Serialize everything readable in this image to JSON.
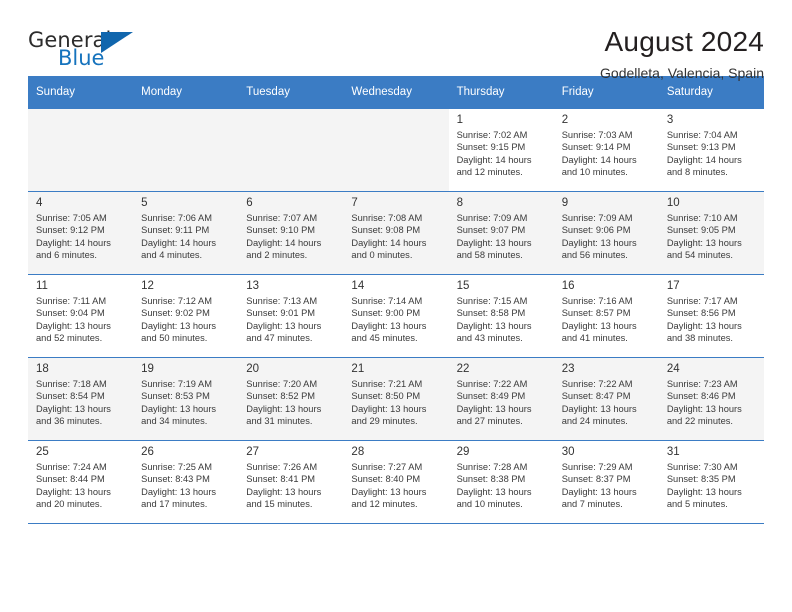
{
  "logo": {
    "word_one": "General",
    "word_two": "Blue",
    "triangle_icon": "blue-triangle-icon",
    "accent_color": "#1673bd"
  },
  "header": {
    "title": "August 2024",
    "subtitle": "Godelleta, Valencia, Spain",
    "header_bg_color": "#3b7cc4",
    "header_text_color": "#ffffff"
  },
  "weekday_headers": [
    "Sunday",
    "Monday",
    "Tuesday",
    "Wednesday",
    "Thursday",
    "Friday",
    "Saturday"
  ],
  "labels": {
    "sunrise_prefix": "Sunrise:",
    "sunset_prefix": "Sunset:",
    "daylight_prefix": "Daylight:"
  },
  "weeks": [
    {
      "index": 0,
      "shaded": false,
      "days": [
        {
          "day": "",
          "empty": true
        },
        {
          "day": "",
          "empty": true
        },
        {
          "day": "",
          "empty": true
        },
        {
          "day": "",
          "empty": true
        },
        {
          "day": "1",
          "sunrise": "Sunrise: 7:02 AM",
          "sunset": "Sunset: 9:15 PM",
          "daylight_line1": "Daylight: 14 hours",
          "daylight_line2": "and 12 minutes."
        },
        {
          "day": "2",
          "sunrise": "Sunrise: 7:03 AM",
          "sunset": "Sunset: 9:14 PM",
          "daylight_line1": "Daylight: 14 hours",
          "daylight_line2": "and 10 minutes."
        },
        {
          "day": "3",
          "sunrise": "Sunrise: 7:04 AM",
          "sunset": "Sunset: 9:13 PM",
          "daylight_line1": "Daylight: 14 hours",
          "daylight_line2": "and 8 minutes."
        }
      ]
    },
    {
      "index": 1,
      "shaded": true,
      "days": [
        {
          "day": "4",
          "sunrise": "Sunrise: 7:05 AM",
          "sunset": "Sunset: 9:12 PM",
          "daylight_line1": "Daylight: 14 hours",
          "daylight_line2": "and 6 minutes."
        },
        {
          "day": "5",
          "sunrise": "Sunrise: 7:06 AM",
          "sunset": "Sunset: 9:11 PM",
          "daylight_line1": "Daylight: 14 hours",
          "daylight_line2": "and 4 minutes."
        },
        {
          "day": "6",
          "sunrise": "Sunrise: 7:07 AM",
          "sunset": "Sunset: 9:10 PM",
          "daylight_line1": "Daylight: 14 hours",
          "daylight_line2": "and 2 minutes."
        },
        {
          "day": "7",
          "sunrise": "Sunrise: 7:08 AM",
          "sunset": "Sunset: 9:08 PM",
          "daylight_line1": "Daylight: 14 hours",
          "daylight_line2": "and 0 minutes."
        },
        {
          "day": "8",
          "sunrise": "Sunrise: 7:09 AM",
          "sunset": "Sunset: 9:07 PM",
          "daylight_line1": "Daylight: 13 hours",
          "daylight_line2": "and 58 minutes."
        },
        {
          "day": "9",
          "sunrise": "Sunrise: 7:09 AM",
          "sunset": "Sunset: 9:06 PM",
          "daylight_line1": "Daylight: 13 hours",
          "daylight_line2": "and 56 minutes."
        },
        {
          "day": "10",
          "sunrise": "Sunrise: 7:10 AM",
          "sunset": "Sunset: 9:05 PM",
          "daylight_line1": "Daylight: 13 hours",
          "daylight_line2": "and 54 minutes."
        }
      ]
    },
    {
      "index": 2,
      "shaded": false,
      "days": [
        {
          "day": "11",
          "sunrise": "Sunrise: 7:11 AM",
          "sunset": "Sunset: 9:04 PM",
          "daylight_line1": "Daylight: 13 hours",
          "daylight_line2": "and 52 minutes."
        },
        {
          "day": "12",
          "sunrise": "Sunrise: 7:12 AM",
          "sunset": "Sunset: 9:02 PM",
          "daylight_line1": "Daylight: 13 hours",
          "daylight_line2": "and 50 minutes."
        },
        {
          "day": "13",
          "sunrise": "Sunrise: 7:13 AM",
          "sunset": "Sunset: 9:01 PM",
          "daylight_line1": "Daylight: 13 hours",
          "daylight_line2": "and 47 minutes."
        },
        {
          "day": "14",
          "sunrise": "Sunrise: 7:14 AM",
          "sunset": "Sunset: 9:00 PM",
          "daylight_line1": "Daylight: 13 hours",
          "daylight_line2": "and 45 minutes."
        },
        {
          "day": "15",
          "sunrise": "Sunrise: 7:15 AM",
          "sunset": "Sunset: 8:58 PM",
          "daylight_line1": "Daylight: 13 hours",
          "daylight_line2": "and 43 minutes."
        },
        {
          "day": "16",
          "sunrise": "Sunrise: 7:16 AM",
          "sunset": "Sunset: 8:57 PM",
          "daylight_line1": "Daylight: 13 hours",
          "daylight_line2": "and 41 minutes."
        },
        {
          "day": "17",
          "sunrise": "Sunrise: 7:17 AM",
          "sunset": "Sunset: 8:56 PM",
          "daylight_line1": "Daylight: 13 hours",
          "daylight_line2": "and 38 minutes."
        }
      ]
    },
    {
      "index": 3,
      "shaded": true,
      "days": [
        {
          "day": "18",
          "sunrise": "Sunrise: 7:18 AM",
          "sunset": "Sunset: 8:54 PM",
          "daylight_line1": "Daylight: 13 hours",
          "daylight_line2": "and 36 minutes."
        },
        {
          "day": "19",
          "sunrise": "Sunrise: 7:19 AM",
          "sunset": "Sunset: 8:53 PM",
          "daylight_line1": "Daylight: 13 hours",
          "daylight_line2": "and 34 minutes."
        },
        {
          "day": "20",
          "sunrise": "Sunrise: 7:20 AM",
          "sunset": "Sunset: 8:52 PM",
          "daylight_line1": "Daylight: 13 hours",
          "daylight_line2": "and 31 minutes."
        },
        {
          "day": "21",
          "sunrise": "Sunrise: 7:21 AM",
          "sunset": "Sunset: 8:50 PM",
          "daylight_line1": "Daylight: 13 hours",
          "daylight_line2": "and 29 minutes."
        },
        {
          "day": "22",
          "sunrise": "Sunrise: 7:22 AM",
          "sunset": "Sunset: 8:49 PM",
          "daylight_line1": "Daylight: 13 hours",
          "daylight_line2": "and 27 minutes."
        },
        {
          "day": "23",
          "sunrise": "Sunrise: 7:22 AM",
          "sunset": "Sunset: 8:47 PM",
          "daylight_line1": "Daylight: 13 hours",
          "daylight_line2": "and 24 minutes."
        },
        {
          "day": "24",
          "sunrise": "Sunrise: 7:23 AM",
          "sunset": "Sunset: 8:46 PM",
          "daylight_line1": "Daylight: 13 hours",
          "daylight_line2": "and 22 minutes."
        }
      ]
    },
    {
      "index": 4,
      "shaded": false,
      "days": [
        {
          "day": "25",
          "sunrise": "Sunrise: 7:24 AM",
          "sunset": "Sunset: 8:44 PM",
          "daylight_line1": "Daylight: 13 hours",
          "daylight_line2": "and 20 minutes."
        },
        {
          "day": "26",
          "sunrise": "Sunrise: 7:25 AM",
          "sunset": "Sunset: 8:43 PM",
          "daylight_line1": "Daylight: 13 hours",
          "daylight_line2": "and 17 minutes."
        },
        {
          "day": "27",
          "sunrise": "Sunrise: 7:26 AM",
          "sunset": "Sunset: 8:41 PM",
          "daylight_line1": "Daylight: 13 hours",
          "daylight_line2": "and 15 minutes."
        },
        {
          "day": "28",
          "sunrise": "Sunrise: 7:27 AM",
          "sunset": "Sunset: 8:40 PM",
          "daylight_line1": "Daylight: 13 hours",
          "daylight_line2": "and 12 minutes."
        },
        {
          "day": "29",
          "sunrise": "Sunrise: 7:28 AM",
          "sunset": "Sunset: 8:38 PM",
          "daylight_line1": "Daylight: 13 hours",
          "daylight_line2": "and 10 minutes."
        },
        {
          "day": "30",
          "sunrise": "Sunrise: 7:29 AM",
          "sunset": "Sunset: 8:37 PM",
          "daylight_line1": "Daylight: 13 hours",
          "daylight_line2": "and 7 minutes."
        },
        {
          "day": "31",
          "sunrise": "Sunrise: 7:30 AM",
          "sunset": "Sunset: 8:35 PM",
          "daylight_line1": "Daylight: 13 hours",
          "daylight_line2": "and 5 minutes."
        }
      ]
    }
  ]
}
